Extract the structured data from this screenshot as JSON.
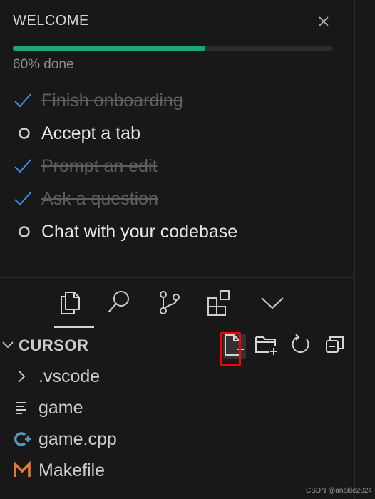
{
  "welcome": {
    "title": "WELCOME",
    "progress_label": "60% done",
    "progress_fraction": 0.6,
    "tasks": [
      {
        "label": "Finish onboarding",
        "done": true
      },
      {
        "label": "Accept a tab",
        "done": false
      },
      {
        "label": "Prompt an edit",
        "done": true
      },
      {
        "label": "Ask a question",
        "done": true
      },
      {
        "label": "Chat with your codebase",
        "done": false
      }
    ]
  },
  "activity_bar": {
    "items": [
      "files-icon",
      "search-icon",
      "source-control-icon",
      "extensions-icon",
      "chevron-down-icon"
    ]
  },
  "explorer": {
    "title": "CURSOR",
    "files": [
      {
        "name": ".vscode",
        "icon": "chevron-right-icon"
      },
      {
        "name": "game",
        "icon": "text-file-icon"
      },
      {
        "name": "game.cpp",
        "icon": "cpp-icon"
      },
      {
        "name": "Makefile",
        "icon": "makefile-icon"
      }
    ]
  },
  "colors": {
    "progress": "#1fa37b",
    "check": "#3b8eea",
    "highlight": "#ff0000"
  },
  "watermark": "CSDN @anakie2024"
}
